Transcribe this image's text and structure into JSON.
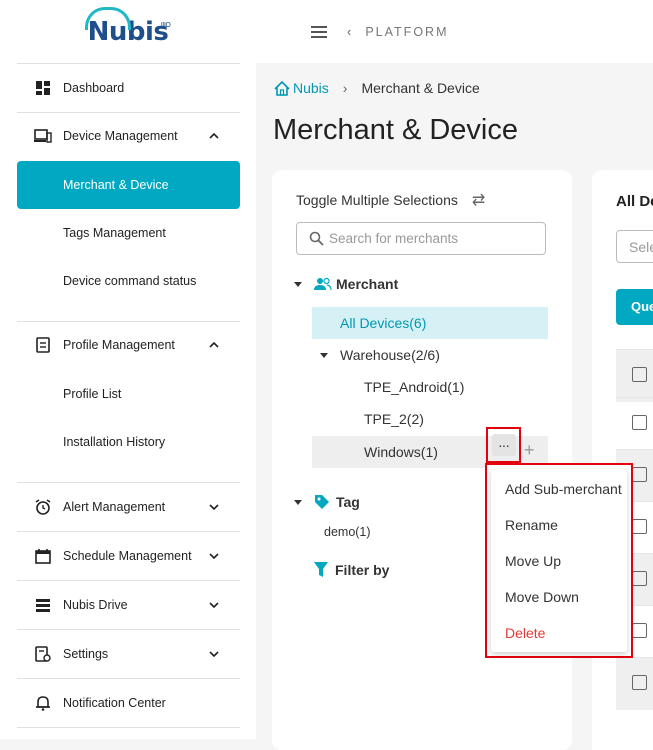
{
  "logo": {
    "text": "Nubis",
    "superscript": "IIIO"
  },
  "sidebar": {
    "items": [
      {
        "label": "Dashboard"
      },
      {
        "label": "Device Management"
      },
      {
        "label": "Merchant & Device"
      },
      {
        "label": "Tags Management"
      },
      {
        "label": "Device command status"
      },
      {
        "label": "Profile Management"
      },
      {
        "label": "Profile List"
      },
      {
        "label": "Installation History"
      },
      {
        "label": "Alert Management"
      },
      {
        "label": "Schedule Management"
      },
      {
        "label": "Nubis Drive"
      },
      {
        "label": "Settings"
      },
      {
        "label": "Notification Center"
      }
    ]
  },
  "topbar": {
    "back_glyph": "‹",
    "title": "PLATFORM"
  },
  "breadcrumb": {
    "home": "Nubis",
    "separator": "›",
    "current": "Merchant & Device"
  },
  "page": {
    "title": "Merchant & Device"
  },
  "left_panel": {
    "toggle_label": "Toggle Multiple Selections",
    "toggle_icon": "⇄",
    "search_placeholder": "Search for merchants",
    "merchant_header": "Merchant",
    "all_devices": "All Devices(6)",
    "warehouse": "Warehouse(2/6)",
    "tpe_android": "TPE_Android(1)",
    "tpe_2": "TPE_2(2)",
    "windows": "Windows(1)",
    "more_glyph": "···",
    "add_glyph": "+",
    "tag_header": "Tag",
    "demo_tag": "demo(1)",
    "filter_header": "Filter by"
  },
  "context_menu": {
    "items": [
      {
        "label": "Add Sub-merchant"
      },
      {
        "label": "Rename"
      },
      {
        "label": "Move Up"
      },
      {
        "label": "Move Down"
      },
      {
        "label": "Delete"
      }
    ]
  },
  "right_panel": {
    "title": "All Devices",
    "select_placeholder": "Select",
    "query_button": "Query"
  },
  "colors": {
    "accent": "#00a8c1",
    "highlight_border": "#e3000f",
    "danger": "#e53935"
  }
}
